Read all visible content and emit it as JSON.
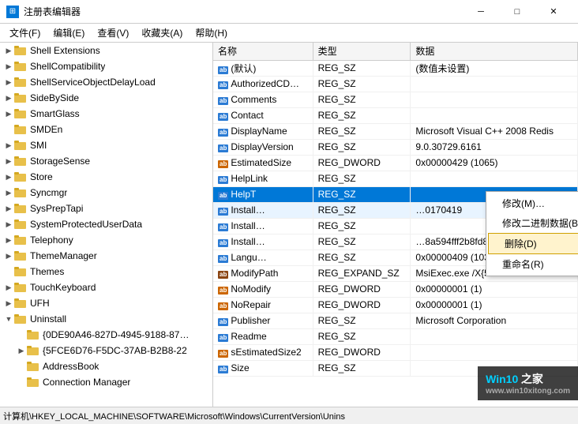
{
  "titleBar": {
    "icon": "⊞",
    "title": "注册表编辑器",
    "minBtn": "─",
    "maxBtn": "□",
    "closeBtn": "✕"
  },
  "menuBar": {
    "items": [
      "文件(F)",
      "编辑(E)",
      "查看(V)",
      "收藏夹(A)",
      "帮助(H)"
    ]
  },
  "treePanel": {
    "items": [
      {
        "indent": 1,
        "expand": "▶",
        "label": "Shell Extensions",
        "selected": false
      },
      {
        "indent": 1,
        "expand": "▶",
        "label": "ShellCompatibility",
        "selected": false
      },
      {
        "indent": 1,
        "expand": "▶",
        "label": "ShellServiceObjectDelayLoad",
        "selected": false
      },
      {
        "indent": 1,
        "expand": "▶",
        "label": "SideBySide",
        "selected": false
      },
      {
        "indent": 1,
        "expand": "▶",
        "label": "SmartGlass",
        "selected": false
      },
      {
        "indent": 1,
        "expand": "",
        "label": "SMDEn",
        "selected": false
      },
      {
        "indent": 1,
        "expand": "▶",
        "label": "SMI",
        "selected": false
      },
      {
        "indent": 1,
        "expand": "▶",
        "label": "StorageSense",
        "selected": false
      },
      {
        "indent": 1,
        "expand": "▶",
        "label": "Store",
        "selected": false
      },
      {
        "indent": 1,
        "expand": "▶",
        "label": "Syncmgr",
        "selected": false
      },
      {
        "indent": 1,
        "expand": "▶",
        "label": "SysPrepTapi",
        "selected": false
      },
      {
        "indent": 1,
        "expand": "▶",
        "label": "SystemProtectedUserData",
        "selected": false
      },
      {
        "indent": 1,
        "expand": "▶",
        "label": "Telephony",
        "selected": false
      },
      {
        "indent": 1,
        "expand": "▶",
        "label": "ThemeManager",
        "selected": false
      },
      {
        "indent": 1,
        "expand": "",
        "label": "Themes",
        "selected": false
      },
      {
        "indent": 1,
        "expand": "▶",
        "label": "TouchKeyboard",
        "selected": false
      },
      {
        "indent": 1,
        "expand": "▶",
        "label": "UFH",
        "selected": false
      },
      {
        "indent": 1,
        "expand": "▼",
        "label": "Uninstall",
        "selected": false
      },
      {
        "indent": 2,
        "expand": "",
        "label": "{0DE90A46-827D-4945-9188-87…",
        "selected": false
      },
      {
        "indent": 2,
        "expand": "▶",
        "label": "{5FCE6D76-F5DC-37AB-B2B8-22",
        "selected": false
      },
      {
        "indent": 2,
        "expand": "",
        "label": "AddressBook",
        "selected": false
      },
      {
        "indent": 2,
        "expand": "",
        "label": "Connection Manager",
        "selected": false
      }
    ]
  },
  "tablePanel": {
    "columns": [
      "名称",
      "类型",
      "数据"
    ],
    "rows": [
      {
        "icon": "ab",
        "name": "(默认)",
        "type": "REG_SZ",
        "data": "(数值未设置)",
        "selected": false,
        "highlight": false
      },
      {
        "icon": "ab",
        "name": "AuthorizedCD…",
        "type": "REG_SZ",
        "data": "",
        "selected": false,
        "highlight": false
      },
      {
        "icon": "ab",
        "name": "Comments",
        "type": "REG_SZ",
        "data": "",
        "selected": false,
        "highlight": false
      },
      {
        "icon": "ab",
        "name": "Contact",
        "type": "REG_SZ",
        "data": "",
        "selected": false,
        "highlight": false
      },
      {
        "icon": "ab",
        "name": "DisplayName",
        "type": "REG_SZ",
        "data": "Microsoft Visual C++ 2008 Redis",
        "selected": false,
        "highlight": false
      },
      {
        "icon": "ab",
        "name": "DisplayVersion",
        "type": "REG_SZ",
        "data": "9.0.30729.6161",
        "selected": false,
        "highlight": false
      },
      {
        "icon": "dword",
        "name": "EstimatedSize",
        "type": "REG_DWORD",
        "data": "0x00000429 (1065)",
        "selected": false,
        "highlight": false
      },
      {
        "icon": "ab",
        "name": "HelpLink",
        "type": "REG_SZ",
        "data": "",
        "selected": false,
        "highlight": false
      },
      {
        "icon": "ab",
        "name": "HelpT",
        "type": "REG_SZ",
        "data": "",
        "selected": true,
        "highlight": false
      },
      {
        "icon": "ab",
        "name": "Install…",
        "type": "REG_SZ",
        "data": "…0170419",
        "selected": false,
        "highlight": true
      },
      {
        "icon": "ab",
        "name": "Install…",
        "type": "REG_SZ",
        "data": "",
        "selected": false,
        "highlight": false
      },
      {
        "icon": "ab",
        "name": "Install…",
        "type": "REG_SZ",
        "data": "…8a594fff2b8fd81ea520df\\",
        "selected": false,
        "highlight": false
      },
      {
        "icon": "ab",
        "name": "Langu…",
        "type": "REG_SZ",
        "data": "0x00000409 (1033)",
        "selected": false,
        "highlight": false
      },
      {
        "icon": "expand",
        "name": "ModifyPath",
        "type": "REG_EXPAND_SZ",
        "data": "MsiExec.exe /X{5FCE6D76-F5DC-",
        "selected": false,
        "highlight": false
      },
      {
        "icon": "dword",
        "name": "NoModify",
        "type": "REG_DWORD",
        "data": "0x00000001 (1)",
        "selected": false,
        "highlight": false
      },
      {
        "icon": "dword",
        "name": "NoRepair",
        "type": "REG_DWORD",
        "data": "0x00000001 (1)",
        "selected": false,
        "highlight": false
      },
      {
        "icon": "ab",
        "name": "Publisher",
        "type": "REG_SZ",
        "data": "Microsoft Corporation",
        "selected": false,
        "highlight": false
      },
      {
        "icon": "ab",
        "name": "Readme",
        "type": "REG_SZ",
        "data": "",
        "selected": false,
        "highlight": false
      },
      {
        "icon": "dword",
        "name": "sEstimatedSize2",
        "type": "REG_DWORD",
        "data": "",
        "selected": false,
        "highlight": false
      },
      {
        "icon": "ab",
        "name": "Size",
        "type": "REG_SZ",
        "data": "",
        "selected": false,
        "highlight": false
      }
    ]
  },
  "contextMenu": {
    "items": [
      {
        "label": "修改(M)…",
        "type": "normal"
      },
      {
        "label": "修改二进制数据(B)…",
        "type": "normal"
      },
      {
        "label": "删除(D)",
        "type": "danger"
      },
      {
        "label": "重命名(R)",
        "type": "normal"
      }
    ]
  },
  "statusBar": {
    "text": "计算机\\HKEY_LOCAL_MACHINE\\SOFTWARE\\Microsoft\\Windows\\CurrentVersion\\Unins"
  },
  "watermark": {
    "line1": "Win10 之家",
    "line2": "www.win10xitong.com"
  }
}
